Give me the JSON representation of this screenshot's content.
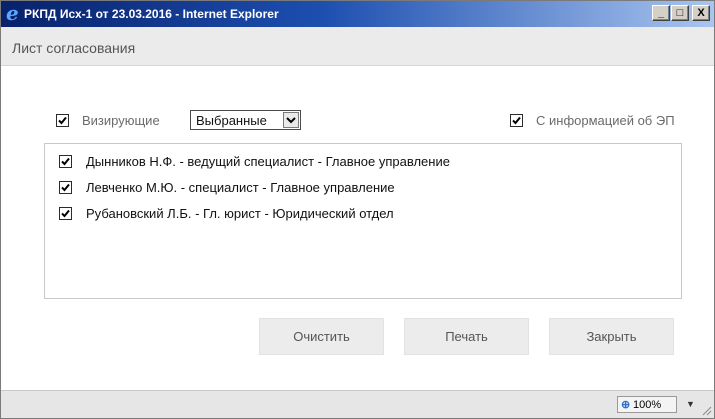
{
  "window": {
    "title": "РКПД Исх-1 от 23.03.2016 - Internet Explorer",
    "app_icon": "ie-icon",
    "controls": {
      "minimize": "_",
      "maximize": "□",
      "close": "X"
    }
  },
  "header": {
    "title": "Лист согласования"
  },
  "filters": {
    "signers_label": "Визирующие",
    "signers_checked": true,
    "select_value": "Выбранные",
    "esig_label": "С информацией об ЭП",
    "esig_checked": true
  },
  "list": {
    "items": [
      {
        "label": "Дынников Н.Ф. - ведущий специалист - Главное управление",
        "checked": true
      },
      {
        "label": "Левченко М.Ю. - специалист - Главное управление",
        "checked": true
      },
      {
        "label": "Рубановский Л.Б. - Гл. юрист - Юридический отдел",
        "checked": true
      }
    ]
  },
  "buttons": {
    "clear": "Очистить",
    "print": "Печать",
    "close": "Закрыть"
  },
  "statusbar": {
    "zoom": "100%"
  },
  "colors": {
    "title_gradient_start": "#08216b",
    "title_gradient_end": "#a9c5ef",
    "header_bg": "#ebebeb"
  }
}
